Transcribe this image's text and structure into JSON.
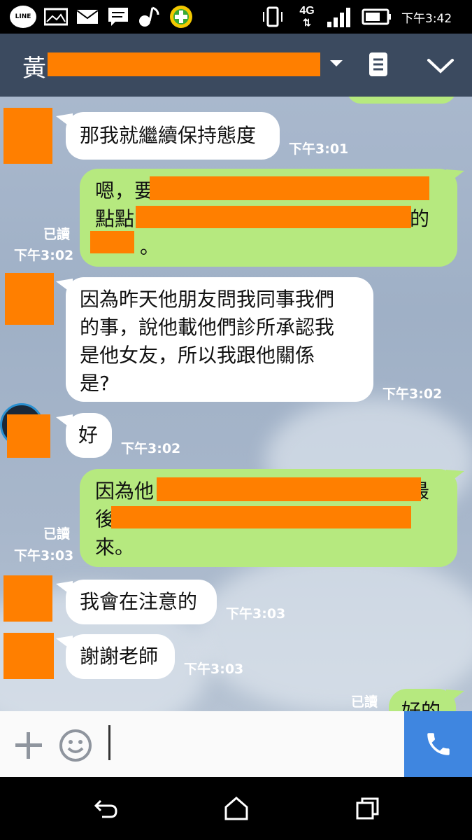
{
  "status_bar": {
    "line_label": "LINE",
    "network": "4G",
    "time": "下午3:42"
  },
  "header": {
    "title_visible": "黃",
    "icons": [
      "chevron-down-icon",
      "notes-icon",
      "collapse-icon"
    ]
  },
  "messages": [
    {
      "dir": "in",
      "text": "那我就繼續保持態度",
      "time": "下午3:01"
    },
    {
      "dir": "out",
      "lines": [
        "嗯，要",
        "點點",
        "的",
        "。"
      ],
      "read": "已讀",
      "time": "下午3:02"
    },
    {
      "dir": "in",
      "lines": [
        "因為昨天他朋友問我同事我們",
        "的事，說他載他們診所承認我",
        "是他女友，所以我跟他關係",
        "是?"
      ],
      "time": "下午3:02"
    },
    {
      "dir": "in",
      "text": "好",
      "time": "下午3:02"
    },
    {
      "dir": "out",
      "lines": [
        "因為他",
        "最",
        "後",
        "來。"
      ],
      "read": "已讀",
      "time": "下午3:03"
    },
    {
      "dir": "in",
      "text": "我會在注意的",
      "time": "下午3:03"
    },
    {
      "dir": "in",
      "text": "謝謝老師",
      "time": "下午3:03"
    },
    {
      "dir": "out",
      "text": "好的",
      "read": "已讀"
    }
  ],
  "input_bar": {
    "icons": [
      "plus-icon",
      "emoji-icon",
      "phone-icon"
    ]
  },
  "nav_bar": {
    "icons": [
      "back-icon",
      "home-icon",
      "recents-icon"
    ]
  },
  "colors": {
    "header": "#3b4a5f",
    "out_bubble": "#b6e97f",
    "in_bubble": "#ffffff",
    "redaction": "#ff7f00",
    "call_button": "#3f86e0"
  }
}
